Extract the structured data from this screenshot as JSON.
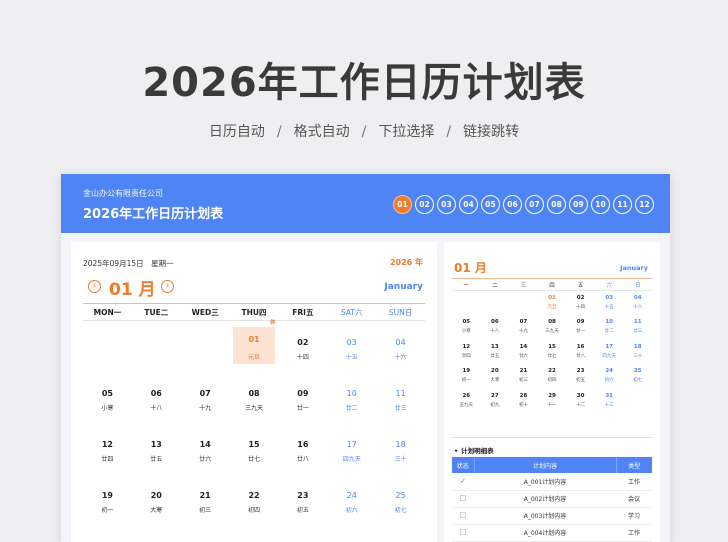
{
  "hero": {
    "title": "2026年工作日历计划表",
    "features": [
      "日历自动",
      "格式自动",
      "下拉选择",
      "链接跳转"
    ],
    "separator": "/"
  },
  "header": {
    "company": "金山办公有限责任公司",
    "title": "2026年工作日历计划表",
    "months": [
      "01",
      "02",
      "03",
      "04",
      "05",
      "06",
      "07",
      "08",
      "09",
      "10",
      "11",
      "12"
    ],
    "active_month": "01"
  },
  "calendar": {
    "current_date": "2025年09月15日　星期一",
    "year_label": "2026 年",
    "prev_icon": "chevron-left-circle-icon",
    "next_icon": "chevron-right-circle-icon",
    "month_label": "01 月",
    "month_en": "January",
    "weekdays": [
      "MON一",
      "TUE二",
      "WED三",
      "THU四",
      "FRI五",
      "SAT六",
      "SUN日"
    ],
    "rest_tag": "休",
    "weeks": [
      [
        {
          "d": "",
          "l": ""
        },
        {
          "d": "",
          "l": ""
        },
        {
          "d": "",
          "l": ""
        },
        {
          "d": "01",
          "l": "元旦",
          "hol": true
        },
        {
          "d": "02",
          "l": "十四"
        },
        {
          "d": "03",
          "l": "十五",
          "we": true
        },
        {
          "d": "04",
          "l": "十六",
          "we": true
        }
      ],
      [
        {
          "d": "05",
          "l": "小寒"
        },
        {
          "d": "06",
          "l": "十八"
        },
        {
          "d": "07",
          "l": "十九"
        },
        {
          "d": "08",
          "l": "三九天"
        },
        {
          "d": "09",
          "l": "廿一"
        },
        {
          "d": "10",
          "l": "廿二",
          "we": true
        },
        {
          "d": "11",
          "l": "廿三",
          "we": true
        }
      ],
      [
        {
          "d": "12",
          "l": "廿四"
        },
        {
          "d": "13",
          "l": "廿五"
        },
        {
          "d": "14",
          "l": "廿六"
        },
        {
          "d": "15",
          "l": "廿七"
        },
        {
          "d": "16",
          "l": "廿八"
        },
        {
          "d": "17",
          "l": "四九天",
          "we": true
        },
        {
          "d": "18",
          "l": "三十",
          "we": true
        }
      ],
      [
        {
          "d": "19",
          "l": "初一"
        },
        {
          "d": "20",
          "l": "大寒"
        },
        {
          "d": "21",
          "l": "初三"
        },
        {
          "d": "22",
          "l": "初四"
        },
        {
          "d": "23",
          "l": "初五"
        },
        {
          "d": "24",
          "l": "初六",
          "we": true
        },
        {
          "d": "25",
          "l": "初七",
          "we": true
        }
      ]
    ]
  },
  "mini": {
    "month_label": "01 月",
    "month_en": "January",
    "weekdays": [
      "一",
      "二",
      "三",
      "四",
      "五",
      "六",
      "日"
    ],
    "weeks": [
      [
        {
          "d": "",
          "l": ""
        },
        {
          "d": "",
          "l": ""
        },
        {
          "d": "",
          "l": ""
        },
        {
          "d": "01",
          "l": "元旦",
          "hol": true
        },
        {
          "d": "02",
          "l": "十四"
        },
        {
          "d": "03",
          "l": "十五",
          "we": true
        },
        {
          "d": "04",
          "l": "十六",
          "we": true
        }
      ],
      [
        {
          "d": "05",
          "l": "小寒"
        },
        {
          "d": "06",
          "l": "十八"
        },
        {
          "d": "07",
          "l": "十九"
        },
        {
          "d": "08",
          "l": "三九天"
        },
        {
          "d": "09",
          "l": "廿一"
        },
        {
          "d": "10",
          "l": "廿二",
          "we": true
        },
        {
          "d": "11",
          "l": "廿三",
          "we": true
        }
      ],
      [
        {
          "d": "12",
          "l": "廿四"
        },
        {
          "d": "13",
          "l": "廿五"
        },
        {
          "d": "14",
          "l": "廿六"
        },
        {
          "d": "15",
          "l": "廿七"
        },
        {
          "d": "16",
          "l": "廿八"
        },
        {
          "d": "17",
          "l": "四九天",
          "we": true
        },
        {
          "d": "18",
          "l": "三十",
          "we": true
        }
      ],
      [
        {
          "d": "19",
          "l": "初一"
        },
        {
          "d": "20",
          "l": "大寒"
        },
        {
          "d": "21",
          "l": "初三"
        },
        {
          "d": "22",
          "l": "初四"
        },
        {
          "d": "23",
          "l": "初五"
        },
        {
          "d": "24",
          "l": "初六",
          "we": true
        },
        {
          "d": "25",
          "l": "初七",
          "we": true
        }
      ],
      [
        {
          "d": "26",
          "l": "五九天"
        },
        {
          "d": "27",
          "l": "初九"
        },
        {
          "d": "28",
          "l": "初十"
        },
        {
          "d": "29",
          "l": "十一"
        },
        {
          "d": "30",
          "l": "十二"
        },
        {
          "d": "31",
          "l": "十三",
          "we": true
        },
        {
          "d": "",
          "l": ""
        }
      ]
    ]
  },
  "plan": {
    "title": "计划明细表",
    "headers": [
      "状态",
      "计划内容",
      "类型"
    ],
    "rows": [
      {
        "status": "✓",
        "done": true,
        "content": "A_001计划内容",
        "type": "工作"
      },
      {
        "status": "☐",
        "done": false,
        "content": "A_002计划内容",
        "type": "会议"
      },
      {
        "status": "☐",
        "done": false,
        "content": "A_003计划内容",
        "type": "学习"
      },
      {
        "status": "☐",
        "done": false,
        "content": "A_004计划内容",
        "type": "工作"
      }
    ]
  },
  "colors": {
    "accent_blue": "#4f84f5",
    "accent_orange": "#ef7c2c",
    "holiday_bg": "#fde3d2"
  }
}
